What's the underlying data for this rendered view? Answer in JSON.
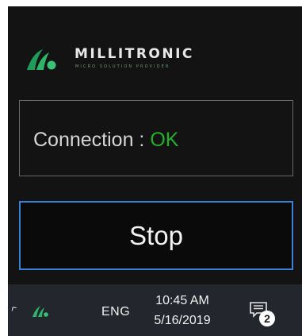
{
  "logo": {
    "name": "MILLITRONIC",
    "tagline": "Micro Solution Provider"
  },
  "connection": {
    "label": "Connection : ",
    "status": "OK"
  },
  "stop_button": {
    "label": "Stop"
  },
  "taskbar": {
    "chevron": "^",
    "language": "ENG",
    "time": "10:45 AM",
    "date": "5/16/2019",
    "notification_count": "2"
  },
  "colors": {
    "panel_bg": "#131313",
    "brand_green": "#2eb36a",
    "status_ok": "#27ae2b",
    "button_border": "#3b7fd6",
    "taskbar_bg": "#23272d"
  },
  "icons": {
    "logo": "millitronic-logo-icon",
    "tray_app": "millitronic-tray-icon",
    "notifications": "action-center-icon"
  }
}
